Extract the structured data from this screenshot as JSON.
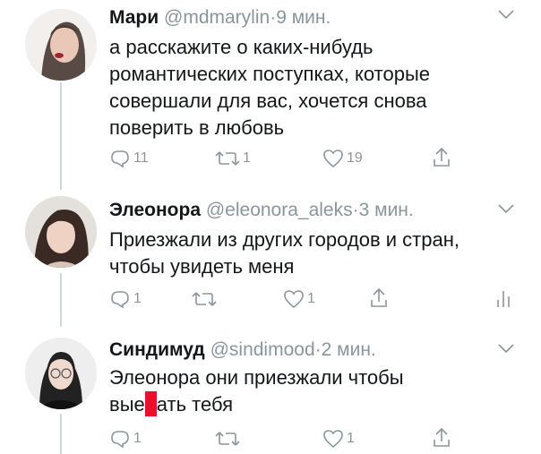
{
  "tweets": [
    {
      "name": "Мари",
      "handle": "@mdmarylin",
      "dot": "·",
      "time": "9 мин.",
      "lines": [
        "а расскажите о каких-нибудь",
        "романтических поступках, которые",
        "совершали для вас, хочется снова",
        "поверить в любовь"
      ],
      "replies": "11",
      "retweets": "1",
      "likes": "19"
    },
    {
      "name": "Элеонора",
      "handle": "@eleonora_aleks",
      "dot": "·",
      "time": "3 мин.",
      "lines": [
        "Приезжали из других городов и стран,",
        "чтобы увидеть меня"
      ],
      "replies": "1",
      "retweets": "",
      "likes": "1"
    },
    {
      "name": "Синдимуд",
      "handle": "@sindimood",
      "dot": "·",
      "time": "2 мин.",
      "line1": "Элеонора они приезжали чтобы",
      "line2_before": "вые",
      "line2_after": "ать тебя",
      "replies": "1",
      "retweets": "",
      "likes": "1"
    }
  ],
  "colors": {
    "text": "#14171a",
    "muted": "#8a969e",
    "redaction": "#e8102a",
    "thread_line": "#cfd9de"
  },
  "icons": [
    "reply-icon",
    "retweet-icon",
    "like-icon",
    "share-icon",
    "analytics-icon",
    "chevron-down-icon"
  ]
}
